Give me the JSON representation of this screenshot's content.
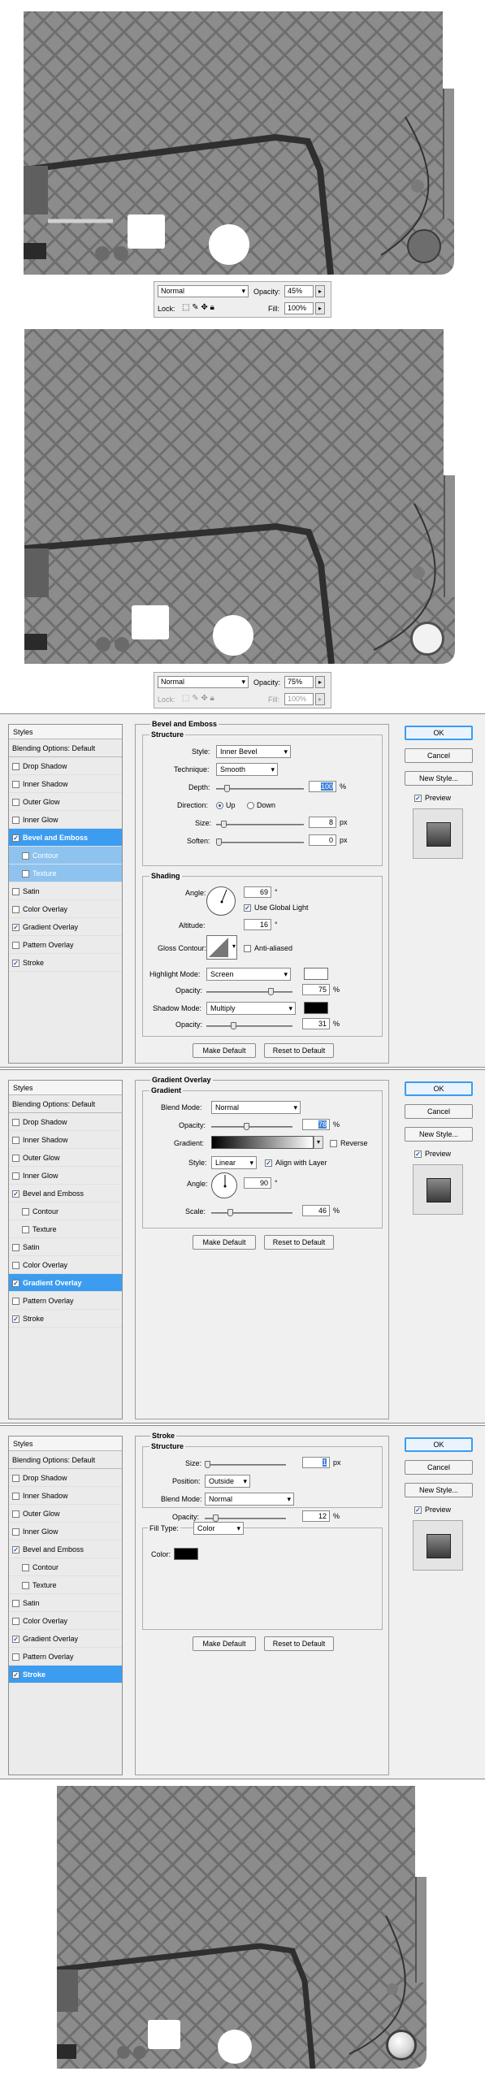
{
  "layer_panel_1": {
    "blend_mode": "Normal",
    "opacity_label": "Opacity:",
    "opacity_value": "45%",
    "lock_label": "Lock:",
    "fill_label": "Fill:",
    "fill_value": "100%",
    "arrow": "▸"
  },
  "layer_panel_2": {
    "blend_mode": "Normal",
    "opacity_label": "Opacity:",
    "opacity_value": "75%",
    "lock_label": "Lock:",
    "fill_label": "Fill:",
    "fill_value": "100%",
    "arrow": "▸"
  },
  "style_list": {
    "header": "Styles",
    "blending": "Blending Options: Default",
    "items": [
      "Drop Shadow",
      "Inner Shadow",
      "Outer Glow",
      "Inner Glow",
      "Bevel and Emboss",
      "Contour",
      "Texture",
      "Satin",
      "Color Overlay",
      "Gradient Overlay",
      "Pattern Overlay",
      "Stroke"
    ]
  },
  "buttons": {
    "ok": "OK",
    "cancel": "Cancel",
    "new_style": "New Style...",
    "preview": "Preview",
    "make_default": "Make Default",
    "reset_default": "Reset to Default"
  },
  "bevel": {
    "title": "Bevel and Emboss",
    "structure": "Structure",
    "style_label": "Style:",
    "style_value": "Inner Bevel",
    "technique_label": "Technique:",
    "technique_value": "Smooth",
    "depth_label": "Depth:",
    "depth_value": "100",
    "depth_unit": "%",
    "direction_label": "Direction:",
    "dir_up": "Up",
    "dir_down": "Down",
    "size_label": "Size:",
    "size_value": "8",
    "size_unit": "px",
    "soften_label": "Soften:",
    "soften_value": "0",
    "soften_unit": "px",
    "shading": "Shading",
    "angle_label": "Angle:",
    "angle_value": "69",
    "angle_unit": "°",
    "global_light": "Use Global Light",
    "altitude_label": "Altitude:",
    "altitude_value": "16",
    "altitude_unit": "°",
    "gloss_label": "Gloss Contour:",
    "antialiased": "Anti-aliased",
    "highlight_label": "Highlight Mode:",
    "highlight_value": "Screen",
    "highlight_color": "#ffffff",
    "hl_opacity_label": "Opacity:",
    "hl_opacity_value": "75",
    "hl_opacity_unit": "%",
    "shadow_label": "Shadow Mode:",
    "shadow_value": "Multiply",
    "shadow_color": "#000000",
    "sh_opacity_label": "Opacity:",
    "sh_opacity_value": "31",
    "sh_opacity_unit": "%"
  },
  "gradient": {
    "title": "Gradient Overlay",
    "section": "Gradient",
    "blend_label": "Blend Mode:",
    "blend_value": "Normal",
    "opacity_label": "Opacity:",
    "opacity_value": "78",
    "opacity_unit": "%",
    "gradient_label": "Gradient:",
    "reverse": "Reverse",
    "style_label": "Style:",
    "style_value": "Linear",
    "align": "Align with Layer",
    "angle_label": "Angle:",
    "angle_value": "90",
    "angle_unit": "°",
    "scale_label": "Scale:",
    "scale_value": "46",
    "scale_unit": "%"
  },
  "stroke": {
    "title": "Stroke",
    "structure": "Structure",
    "size_label": "Size:",
    "size_value": "1",
    "size_unit": "px",
    "position_label": "Position:",
    "position_value": "Outside",
    "blend_label": "Blend Mode:",
    "blend_value": "Normal",
    "opacity_label": "Opacity:",
    "opacity_value": "12",
    "opacity_unit": "%",
    "filltype_label": "Fill Type:",
    "filltype_value": "Color",
    "color_label": "Color:",
    "color_value": "#000000"
  },
  "colors": {
    "accent": "#3c9cf0",
    "canvas_gray": "#8c8c8c"
  }
}
